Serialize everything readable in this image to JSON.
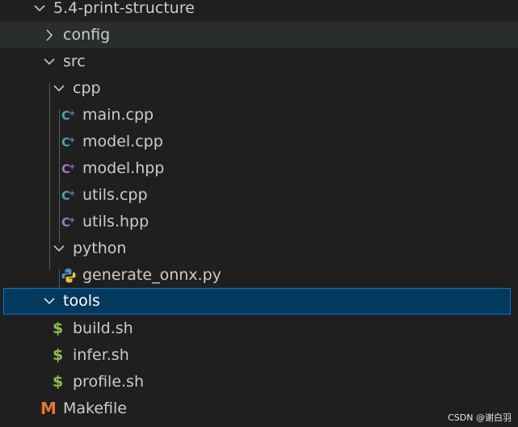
{
  "explorer": {
    "items": [
      {
        "label": "5.4-print-structure",
        "kind": "folder",
        "expanded": true
      },
      {
        "label": "config",
        "kind": "folder",
        "expanded": false
      },
      {
        "label": "src",
        "kind": "folder",
        "expanded": true
      },
      {
        "label": "cpp",
        "kind": "folder",
        "expanded": true
      },
      {
        "label": "main.cpp",
        "kind": "file",
        "icon": "cpp-file-icon"
      },
      {
        "label": "model.cpp",
        "kind": "file",
        "icon": "cpp-file-icon"
      },
      {
        "label": "model.hpp",
        "kind": "file",
        "icon": "hpp-file-icon"
      },
      {
        "label": "utils.cpp",
        "kind": "file",
        "icon": "cpp-file-icon"
      },
      {
        "label": "utils.hpp",
        "kind": "file",
        "icon": "hpp-file-icon"
      },
      {
        "label": "python",
        "kind": "folder",
        "expanded": true
      },
      {
        "label": "generate_onnx.py",
        "kind": "file",
        "icon": "python-file-icon"
      },
      {
        "label": "tools",
        "kind": "folder",
        "expanded": true,
        "selected": true
      },
      {
        "label": "build.sh",
        "kind": "file",
        "icon": "shell-file-icon"
      },
      {
        "label": "infer.sh",
        "kind": "file",
        "icon": "shell-file-icon"
      },
      {
        "label": "profile.sh",
        "kind": "file",
        "icon": "shell-file-icon"
      },
      {
        "label": "Makefile",
        "kind": "file",
        "icon": "makefile-icon"
      }
    ]
  },
  "icons": {
    "shell_glyph": "$",
    "makefile_glyph": "M"
  },
  "colors": {
    "background": "#1f1f1f",
    "hover": "#2a2d2e",
    "selected_bg": "#04395e",
    "selected_border": "#0078d4",
    "cpp_icon": "#519aba",
    "hpp_icon": "#a074c4",
    "shell_icon": "#8dc149",
    "makefile_icon": "#e37933"
  },
  "watermark": "CSDN @谢白羽"
}
